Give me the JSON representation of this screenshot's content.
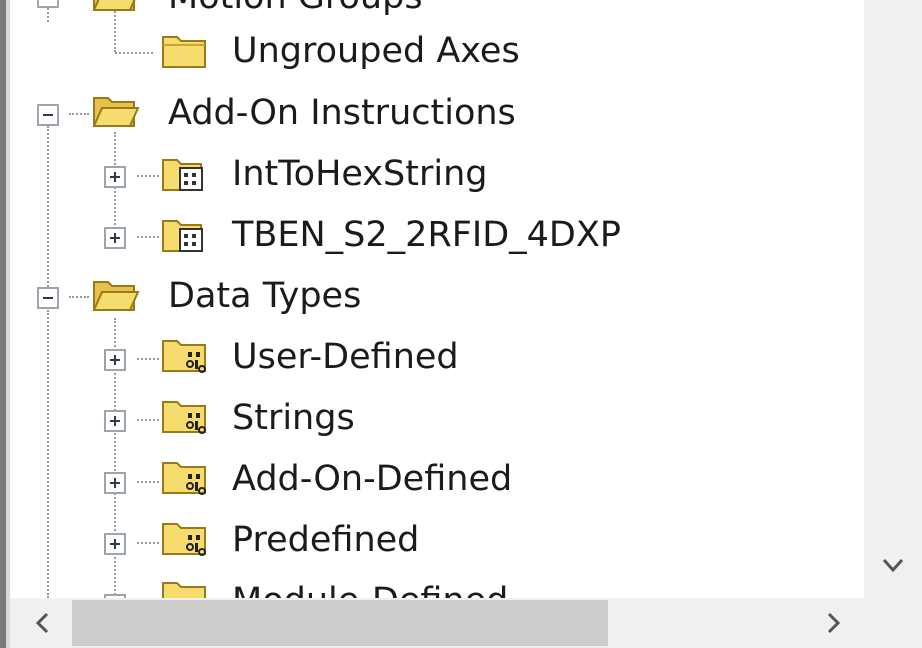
{
  "tree": {
    "items": [
      {
        "label": "Motion Groups",
        "icon": "folder-open-icon",
        "expander": "minus"
      },
      {
        "label": "Ungrouped Axes",
        "icon": "folder-closed-icon",
        "expander": "none"
      },
      {
        "label": "Add-On Instructions",
        "icon": "folder-open-icon",
        "expander": "minus"
      },
      {
        "label": "IntToHexString",
        "icon": "aoi-folder-icon",
        "expander": "plus"
      },
      {
        "label": "TBEN_S2_2RFID_4DXP",
        "icon": "aoi-folder-icon",
        "expander": "plus"
      },
      {
        "label": "Data Types",
        "icon": "folder-open-icon",
        "expander": "minus"
      },
      {
        "label": "User-Defined",
        "icon": "data-type-folder-icon",
        "expander": "plus"
      },
      {
        "label": "Strings",
        "icon": "data-type-folder-icon",
        "expander": "plus"
      },
      {
        "label": "Add-On-Defined",
        "icon": "data-type-folder-icon",
        "expander": "plus"
      },
      {
        "label": "Predefined",
        "icon": "data-type-folder-icon",
        "expander": "plus"
      },
      {
        "label": "Module-Defined",
        "icon": "data-type-folder-icon",
        "expander": "plus"
      }
    ]
  },
  "scrollbars": {
    "vertical_icon": "chevron-down-icon",
    "horizontal_left_icon": "chevron-left-icon",
    "horizontal_right_icon": "chevron-right-icon"
  },
  "colors": {
    "folder_yellow": "#f6dc6e",
    "folder_dark": "#c9a52a",
    "scrollbar_track": "#f0f0f0",
    "scrollbar_thumb": "#cdcdcd"
  }
}
